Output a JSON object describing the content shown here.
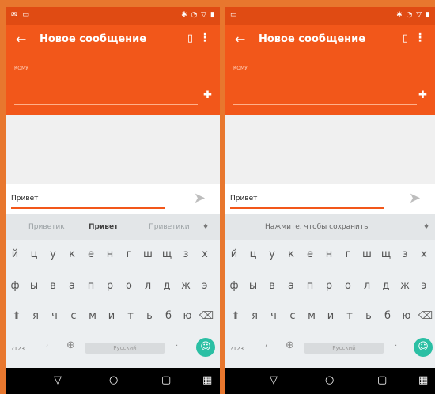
{
  "left": {
    "appbar": {
      "title": "Новое сообщение"
    },
    "recipient": {
      "label": "КОМУ"
    },
    "compose": {
      "text": "Привет"
    },
    "suggestions": [
      "Приветик",
      "Привет",
      "Приветики"
    ],
    "keys": {
      "row1": [
        "й",
        "ц",
        "у",
        "к",
        "е",
        "н",
        "г",
        "ш",
        "щ",
        "з",
        "х"
      ],
      "row2": [
        "ф",
        "ы",
        "в",
        "а",
        "п",
        "р",
        "о",
        "л",
        "д",
        "ж",
        "э"
      ],
      "row3": [
        "я",
        "ч",
        "с",
        "м",
        "и",
        "т",
        "ь",
        "б",
        "ю"
      ]
    },
    "bottom": {
      "sym": "?123",
      "space": "Русский"
    }
  },
  "right": {
    "appbar": {
      "title": "Новое сообщение"
    },
    "recipient": {
      "label": "КОМУ"
    },
    "compose": {
      "text": "Привет"
    },
    "suggestion_hint": "Нажмите, чтобы сохранить",
    "keys": {
      "row1": [
        "й",
        "ц",
        "у",
        "к",
        "е",
        "н",
        "г",
        "ш",
        "щ",
        "з",
        "х"
      ],
      "row2": [
        "ф",
        "ы",
        "в",
        "а",
        "п",
        "р",
        "о",
        "л",
        "д",
        "ж",
        "э"
      ],
      "row3": [
        "я",
        "ч",
        "с",
        "м",
        "и",
        "т",
        "ь",
        "б",
        "ю"
      ]
    },
    "bottom": {
      "sym": "?123",
      "space": "Русский"
    }
  },
  "colors": {
    "appbar": "#f2571a",
    "statusbar": "#e04b13",
    "accent": "#2bbfa4",
    "frame": "#e8772e"
  }
}
